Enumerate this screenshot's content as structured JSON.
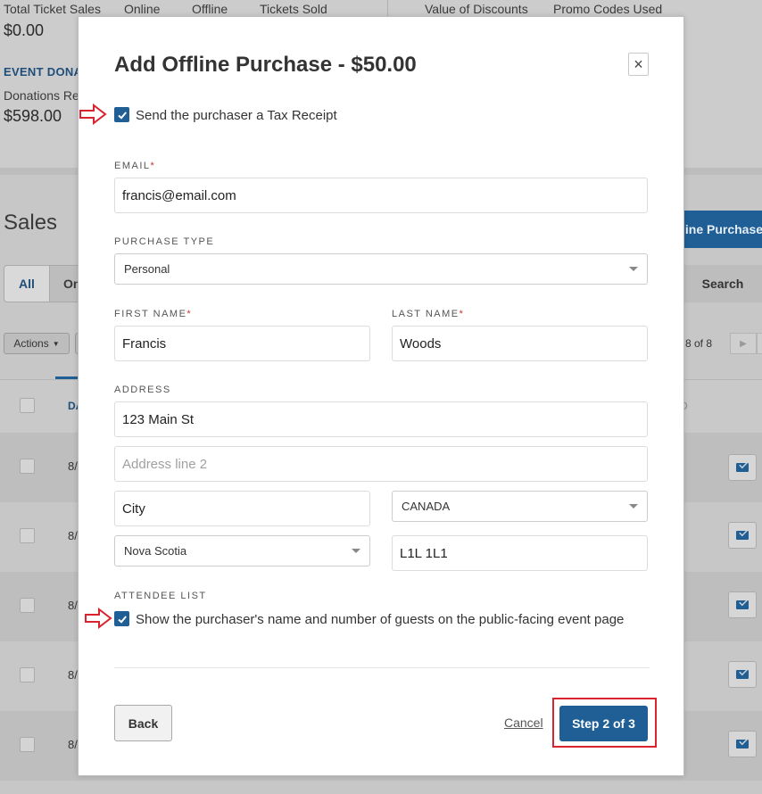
{
  "background": {
    "stats": {
      "labels": [
        "Total Ticket Sales",
        "Online",
        "Offline",
        "Tickets Sold",
        "Value of Discounts",
        "Promo Codes Used"
      ],
      "total_value": "$0.00"
    },
    "donations": {
      "title": "EVENT DONA",
      "label": "Donations Re",
      "value": "$598.00"
    },
    "sales": {
      "heading": "Sales",
      "filter_all": "All",
      "filter_online": "On",
      "online_purchase_button": "line Purchase",
      "search_label": "Search",
      "actions_label": "Actions",
      "pager_text": "8 of 8",
      "col_date": "DA",
      "col_d": "D",
      "row_dates": [
        "8/",
        "8/",
        "8/",
        "8/",
        "8/"
      ]
    }
  },
  "modal": {
    "title": "Add Offline Purchase - $50.00",
    "close_symbol": "×",
    "tax_receipt_label": "Send the purchaser a Tax Receipt",
    "email": {
      "label": "EMAIL",
      "required_mark": "*",
      "value": "francis@email.com"
    },
    "purchase_type": {
      "label": "PURCHASE TYPE",
      "selected": "Personal"
    },
    "first_name": {
      "label": "FIRST NAME",
      "required_mark": "*",
      "value": "Francis"
    },
    "last_name": {
      "label": "LAST NAME",
      "required_mark": "*",
      "value": "Woods"
    },
    "address": {
      "label": "ADDRESS",
      "line1": "123 Main St",
      "line2_placeholder": "Address line 2",
      "city": "City",
      "country": "CANADA",
      "province": "Nova Scotia",
      "postal_code": "L1L 1L1"
    },
    "attendee_list": {
      "label": "ATTENDEE LIST",
      "checkbox_label": "Show the purchaser's name and number of guests on the public-facing event page"
    },
    "buttons": {
      "back": "Back",
      "cancel": "Cancel",
      "next": "Step 2 of 3"
    }
  },
  "colors": {
    "accent": "#1f5f96",
    "annotation_red": "#d9232e",
    "required_red": "#c0392b"
  }
}
